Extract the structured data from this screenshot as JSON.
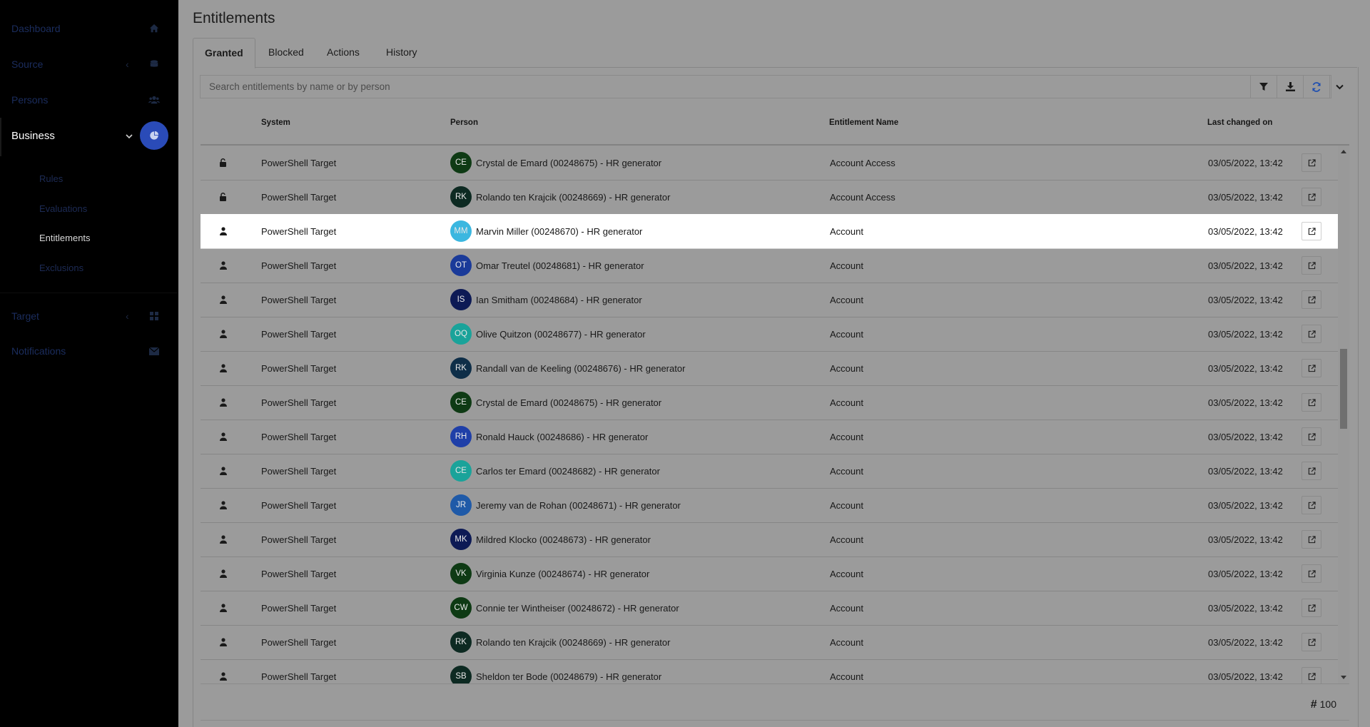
{
  "sidebar": {
    "items": [
      {
        "label": "Dashboard",
        "icon": "home-icon"
      },
      {
        "label": "Source",
        "icon": "database-icon"
      },
      {
        "label": "Persons",
        "icon": "users-icon"
      },
      {
        "label": "Business",
        "icon": "pie-chart-icon"
      },
      {
        "label": "Target",
        "icon": "grid-icon"
      },
      {
        "label": "Notifications",
        "icon": "envelope-icon"
      }
    ],
    "business_sub": [
      "Rules",
      "Evaluations",
      "Entitlements",
      "Exclusions"
    ],
    "active": "Entitlements"
  },
  "main": {
    "title": "Entitlements",
    "tabs": [
      {
        "label": "Granted"
      },
      {
        "label": "Blocked"
      },
      {
        "label": "Actions"
      },
      {
        "label": "History"
      }
    ],
    "search_placeholder": "Search entitlements by name or by person",
    "columns": [
      "System",
      "Person",
      "Entitlement Name",
      "Last changed on"
    ],
    "rows": [
      {
        "type": "unlock",
        "system": "PowerShell Target",
        "initials": "CE",
        "avatar_color": "#0e3a14",
        "person": "Crystal de Emard (00248675) - HR generator",
        "entitlement": "Account Access",
        "date": "03/05/2022, 13:42"
      },
      {
        "type": "unlock",
        "system": "PowerShell Target",
        "initials": "RK",
        "avatar_color": "#0d2a22",
        "person": "Rolando ten Krajcik (00248669) - HR generator",
        "entitlement": "Account Access",
        "date": "03/05/2022, 13:42"
      },
      {
        "type": "user",
        "system": "PowerShell Target",
        "initials": "MM",
        "avatar_color": "#3bb7e0",
        "person": "Marvin Miller (00248670) - HR generator",
        "entitlement": "Account",
        "date": "03/05/2022, 13:42",
        "highlight": true
      },
      {
        "type": "user",
        "system": "PowerShell Target",
        "initials": "OT",
        "avatar_color": "#1a3a99",
        "person": "Omar Treutel (00248681) - HR generator",
        "entitlement": "Account",
        "date": "03/05/2022, 13:42"
      },
      {
        "type": "user",
        "system": "PowerShell Target",
        "initials": "IS",
        "avatar_color": "#0d1a55",
        "person": "Ian Smitham (00248684) - HR generator",
        "entitlement": "Account",
        "date": "03/05/2022, 13:42"
      },
      {
        "type": "user",
        "system": "PowerShell Target",
        "initials": "OQ",
        "avatar_color": "#1aa39a",
        "person": "Olive Quitzon (00248677) - HR generator",
        "entitlement": "Account",
        "date": "03/05/2022, 13:42"
      },
      {
        "type": "user",
        "system": "PowerShell Target",
        "initials": "RK",
        "avatar_color": "#0e2e48",
        "person": "Randall van de Keeling (00248676) - HR generator",
        "entitlement": "Account",
        "date": "03/05/2022, 13:42"
      },
      {
        "type": "user",
        "system": "PowerShell Target",
        "initials": "CE",
        "avatar_color": "#0e3a14",
        "person": "Crystal de Emard (00248675) - HR generator",
        "entitlement": "Account",
        "date": "03/05/2022, 13:42"
      },
      {
        "type": "user",
        "system": "PowerShell Target",
        "initials": "RH",
        "avatar_color": "#1f3fa8",
        "person": "Ronald Hauck (00248686) - HR generator",
        "entitlement": "Account",
        "date": "03/05/2022, 13:42"
      },
      {
        "type": "user",
        "system": "PowerShell Target",
        "initials": "CE",
        "avatar_color": "#1aa39a",
        "person": "Carlos ter Emard (00248682) - HR generator",
        "entitlement": "Account",
        "date": "03/05/2022, 13:42"
      },
      {
        "type": "user",
        "system": "PowerShell Target",
        "initials": "JR",
        "avatar_color": "#1f5aa8",
        "person": "Jeremy van de Rohan (00248671) - HR generator",
        "entitlement": "Account",
        "date": "03/05/2022, 13:42"
      },
      {
        "type": "user",
        "system": "PowerShell Target",
        "initials": "MK",
        "avatar_color": "#0d1a55",
        "person": "Mildred Klocko (00248673) - HR generator",
        "entitlement": "Account",
        "date": "03/05/2022, 13:42"
      },
      {
        "type": "user",
        "system": "PowerShell Target",
        "initials": "VK",
        "avatar_color": "#0e3a14",
        "person": "Virginia Kunze (00248674) - HR generator",
        "entitlement": "Account",
        "date": "03/05/2022, 13:42"
      },
      {
        "type": "user",
        "system": "PowerShell Target",
        "initials": "CW",
        "avatar_color": "#0e3a14",
        "person": "Connie ter Wintheiser (00248672) - HR generator",
        "entitlement": "Account",
        "date": "03/05/2022, 13:42"
      },
      {
        "type": "user",
        "system": "PowerShell Target",
        "initials": "RK",
        "avatar_color": "#0d2a22",
        "person": "Rolando ten Krajcik (00248669) - HR generator",
        "entitlement": "Account",
        "date": "03/05/2022, 13:42"
      },
      {
        "type": "user",
        "system": "PowerShell Target",
        "initials": "SB",
        "avatar_color": "#0d2a22",
        "person": "Sheldon ter Bode (00248679) - HR generator",
        "entitlement": "Account",
        "date": "03/05/2022, 13:42"
      }
    ],
    "count": "100"
  }
}
